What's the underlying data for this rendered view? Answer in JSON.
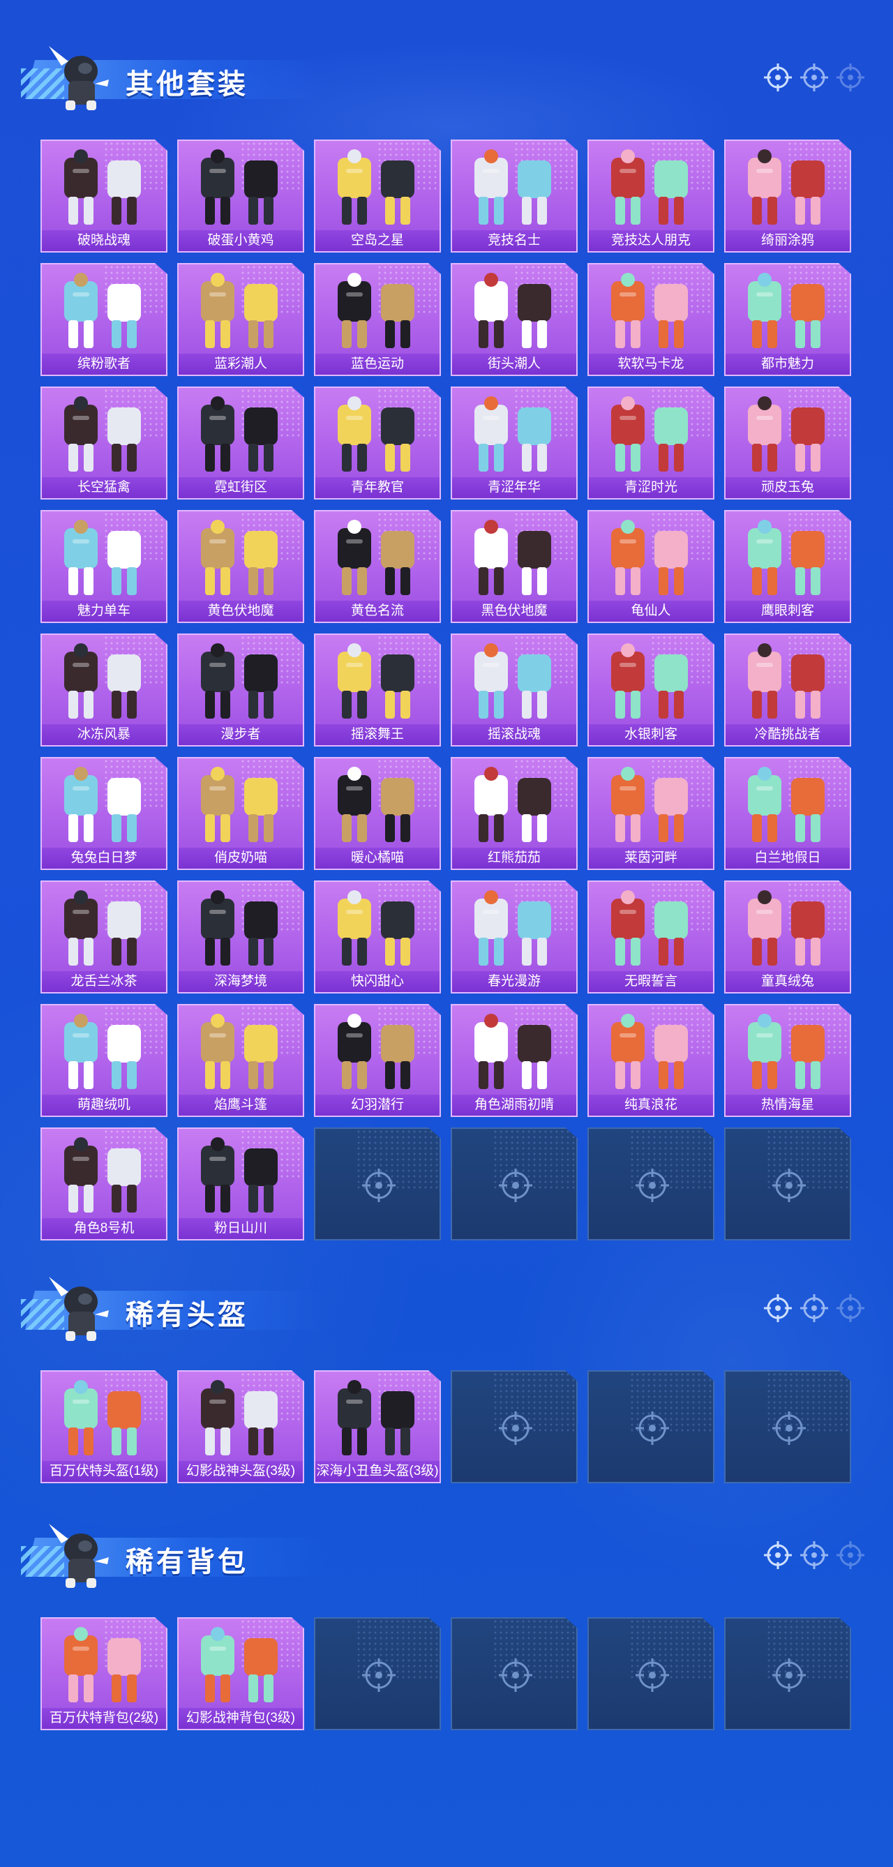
{
  "sections": [
    {
      "title": "其他套装",
      "items": [
        "破晓战魂",
        "破蛋小黄鸡",
        "空岛之星",
        "竞技名士",
        "竞技达人朋克",
        "绮丽涂鸦",
        "缤粉歌者",
        "蓝彩潮人",
        "蓝色运动",
        "街头潮人",
        "软软马卡龙",
        "都市魅力",
        "长空猛禽",
        "霓虹街区",
        "青年教官",
        "青涩年华",
        "青涩时光",
        "顽皮玉兔",
        "魅力单车",
        "黄色伏地魔",
        "黄色名流",
        "黑色伏地魔",
        "龟仙人",
        "鹰眼刺客",
        "冰冻风暴",
        "漫步者",
        "摇滚舞王",
        "摇滚战魂",
        "水银刺客",
        "冷酷挑战者",
        "兔兔白日梦",
        "俏皮奶喵",
        "暖心橘喵",
        "红熊茄茄",
        "莱茵河畔",
        "白兰地假日",
        "龙舌兰冰茶",
        "深海梦境",
        "快闪甜心",
        "春光漫游",
        "无暇誓言",
        "童真绒兔",
        "萌趣绒叽",
        "焰鹰斗篷",
        "幻羽潜行",
        "角色湖雨初晴",
        "纯真浪花",
        "热情海星",
        "角色8号机",
        "粉日山川"
      ],
      "empty_slots": 4
    },
    {
      "title": "稀有头盔",
      "items": [
        "百万伏特头盔(1级)",
        "幻影战神头盔(3级)",
        "深海小丑鱼头盔(3级)"
      ],
      "empty_slots": 3
    },
    {
      "title": "稀有背包",
      "items": [
        "百万伏特背包(2级)",
        "幻影战神背包(3级)"
      ],
      "empty_slots": 4
    }
  ],
  "colors": {
    "card": "#ad60ea",
    "card_label": "#8a3edc",
    "empty_slot": "#1f4078",
    "background": "#1b4fd6"
  }
}
